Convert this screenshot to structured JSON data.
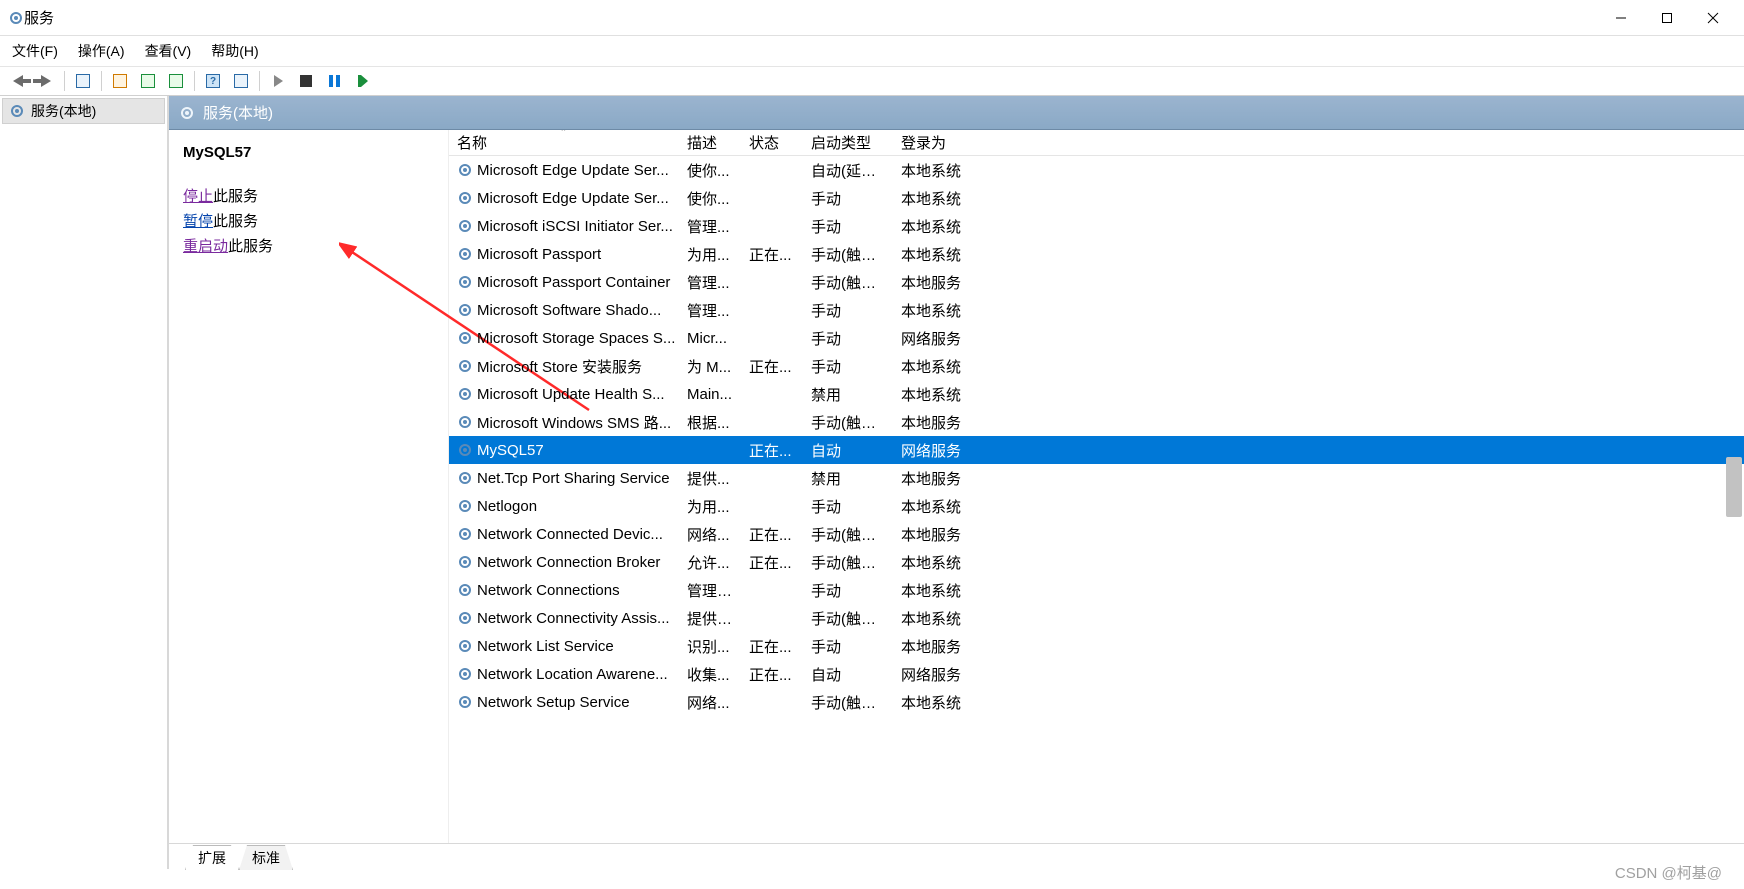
{
  "window": {
    "title": "服务",
    "controls": {
      "minimize": "—",
      "maximize": "☐",
      "close": "✕"
    }
  },
  "menu": {
    "file": "文件(F)",
    "action": "操作(A)",
    "view": "查看(V)",
    "help": "帮助(H)"
  },
  "leftpane": {
    "root": "服务(本地)"
  },
  "panelHeader": "服务(本地)",
  "detail": {
    "serviceName": "MySQL57",
    "actions": {
      "stop_link": "停止",
      "stop_rest": "此服务",
      "pause_link": "暂停",
      "pause_rest": "此服务",
      "restart_link": "重启动",
      "restart_rest": "此服务"
    }
  },
  "columns": {
    "name": "名称",
    "description": "描述",
    "status": "状态",
    "startup": "启动类型",
    "logon": "登录为"
  },
  "tabs": {
    "extended": "扩展",
    "standard": "标准"
  },
  "watermark": "CSDN @柯基@",
  "services": [
    {
      "name": "Microsoft Edge Update Ser...",
      "desc": "使你...",
      "status": "",
      "startup": "自动(延迟...",
      "logon": "本地系统"
    },
    {
      "name": "Microsoft Edge Update Ser...",
      "desc": "使你...",
      "status": "",
      "startup": "手动",
      "logon": "本地系统"
    },
    {
      "name": "Microsoft iSCSI Initiator Ser...",
      "desc": "管理...",
      "status": "",
      "startup": "手动",
      "logon": "本地系统"
    },
    {
      "name": "Microsoft Passport",
      "desc": "为用...",
      "status": "正在...",
      "startup": "手动(触发...",
      "logon": "本地系统"
    },
    {
      "name": "Microsoft Passport Container",
      "desc": "管理...",
      "status": "",
      "startup": "手动(触发...",
      "logon": "本地服务"
    },
    {
      "name": "Microsoft Software Shado...",
      "desc": "管理...",
      "status": "",
      "startup": "手动",
      "logon": "本地系统"
    },
    {
      "name": "Microsoft Storage Spaces S...",
      "desc": "Micr...",
      "status": "",
      "startup": "手动",
      "logon": "网络服务"
    },
    {
      "name": "Microsoft Store 安装服务",
      "desc": "为 M...",
      "status": "正在...",
      "startup": "手动",
      "logon": "本地系统"
    },
    {
      "name": "Microsoft Update Health S...",
      "desc": "Main...",
      "status": "",
      "startup": "禁用",
      "logon": "本地系统"
    },
    {
      "name": "Microsoft Windows SMS 路...",
      "desc": "根据...",
      "status": "",
      "startup": "手动(触发...",
      "logon": "本地服务"
    },
    {
      "name": "MySQL57",
      "desc": "",
      "status": "正在...",
      "startup": "自动",
      "logon": "网络服务",
      "selected": true
    },
    {
      "name": "Net.Tcp Port Sharing Service",
      "desc": "提供...",
      "status": "",
      "startup": "禁用",
      "logon": "本地服务"
    },
    {
      "name": "Netlogon",
      "desc": "为用...",
      "status": "",
      "startup": "手动",
      "logon": "本地系统"
    },
    {
      "name": "Network Connected Devic...",
      "desc": "网络...",
      "status": "正在...",
      "startup": "手动(触发...",
      "logon": "本地服务"
    },
    {
      "name": "Network Connection Broker",
      "desc": "允许...",
      "status": "正在...",
      "startup": "手动(触发...",
      "logon": "本地系统"
    },
    {
      "name": "Network Connections",
      "desc": "管理\"...",
      "status": "",
      "startup": "手动",
      "logon": "本地系统"
    },
    {
      "name": "Network Connectivity Assis...",
      "desc": "提供 ...",
      "status": "",
      "startup": "手动(触发...",
      "logon": "本地系统"
    },
    {
      "name": "Network List Service",
      "desc": "识别...",
      "status": "正在...",
      "startup": "手动",
      "logon": "本地服务"
    },
    {
      "name": "Network Location Awarene...",
      "desc": "收集...",
      "status": "正在...",
      "startup": "自动",
      "logon": "网络服务"
    },
    {
      "name": "Network Setup Service",
      "desc": "网络...",
      "status": "",
      "startup": "手动(触发...",
      "logon": "本地系统"
    }
  ]
}
